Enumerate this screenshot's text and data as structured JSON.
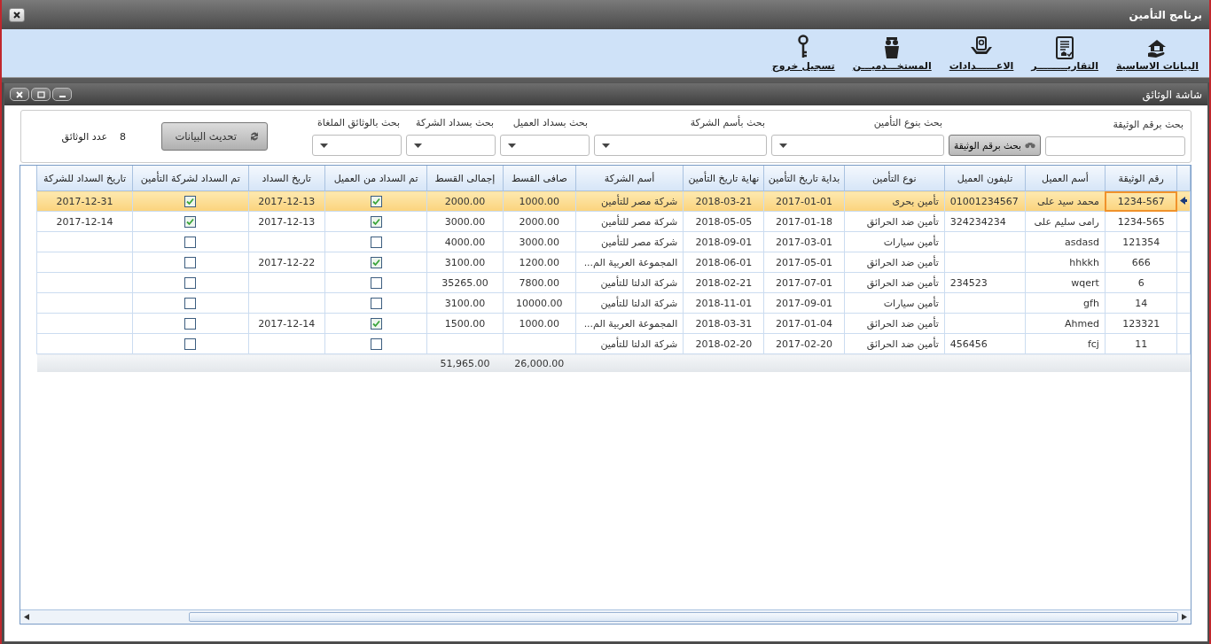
{
  "window": {
    "title": "برنامج التأمين"
  },
  "ribbon": [
    {
      "label": "البيانات الاساسية"
    },
    {
      "label": "التقاريـــــــــر"
    },
    {
      "label": "الاعــــــدادات"
    },
    {
      "label": "المستخـــدميـــن"
    },
    {
      "label": "تسجيل خروج"
    }
  ],
  "child_window": {
    "title": "شاشة الوثائق"
  },
  "filters": [
    {
      "label": "بحث برقم الوثيقة",
      "kind": "text"
    },
    {
      "kind": "button",
      "label": "بحث برقم الوثيقة"
    },
    {
      "label": "بحث بنوع التأمين",
      "kind": "combo"
    },
    {
      "label": "بحث بأسم الشركة",
      "kind": "combo"
    },
    {
      "label": "بحث بسداد العميل",
      "kind": "combo"
    },
    {
      "label": "بحث بسداد الشركة",
      "kind": "combo"
    },
    {
      "label": "بحث بالوثائق الملغاة",
      "kind": "combo"
    }
  ],
  "refresh_button": "تحديث البيانات",
  "count": {
    "value": "8",
    "label": "عدد الوثائق"
  },
  "table": {
    "columns": [
      {
        "label": "رقم الوثيقة",
        "kind": "text"
      },
      {
        "label": "أسم العميل",
        "kind": "text"
      },
      {
        "label": "تليفون العميل",
        "kind": "text"
      },
      {
        "label": "نوع التأمين",
        "kind": "text"
      },
      {
        "label": "بداية تاريخ التأمين",
        "kind": "text"
      },
      {
        "label": "نهاية تاريخ التأمين",
        "kind": "text"
      },
      {
        "label": "أسم الشركة",
        "kind": "text"
      },
      {
        "label": "صافى القسط",
        "kind": "text"
      },
      {
        "label": "إجمالى القسط",
        "kind": "text"
      },
      {
        "label": "تم السداد من العميل",
        "kind": "check"
      },
      {
        "label": "تاريخ السداد",
        "kind": "text"
      },
      {
        "label": "تم السداد لشركة التأمين",
        "kind": "check"
      },
      {
        "label": "تاريخ السداد للشركة",
        "kind": "text"
      }
    ],
    "rows": [
      {
        "selected": true,
        "cells": [
          "1234-567",
          "محمد سيد على",
          "01001234567",
          "تأمين بحرى",
          "2017-01-01",
          "2018-03-21",
          "شركة مصر للتأمين",
          "1000.00",
          "2000.00",
          true,
          "2017-12-13",
          true,
          "2017-12-31"
        ]
      },
      {
        "selected": false,
        "cells": [
          "1234-565",
          "رامى سليم على",
          "324234234",
          "تأمين ضد الحرائق",
          "2017-01-18",
          "2018-05-05",
          "شركة مصر للتأمين",
          "2000.00",
          "3000.00",
          true,
          "2017-12-13",
          true,
          "2017-12-14"
        ]
      },
      {
        "selected": false,
        "cells": [
          "121354",
          "asdasd",
          null,
          "تأمين سيارات",
          "2017-03-01",
          "2018-09-01",
          "شركة مصر للتأمين",
          "3000.00",
          "4000.00",
          false,
          null,
          false,
          null
        ]
      },
      {
        "selected": false,
        "cells": [
          "666",
          "hhkkh",
          null,
          "تأمين ضد الحرائق",
          "2017-05-01",
          "2018-06-01",
          "المجموعة العربية الم...",
          "1200.00",
          "3100.00",
          true,
          "2017-12-22",
          false,
          null
        ]
      },
      {
        "selected": false,
        "cells": [
          "6",
          "wqert",
          "234523",
          "تأمين ضد الحرائق",
          "2017-07-01",
          "2018-02-21",
          "شركة الدلتا للتأمين",
          "7800.00",
          "35265.00",
          false,
          null,
          false,
          null
        ]
      },
      {
        "selected": false,
        "cells": [
          "14",
          "gfh",
          null,
          "تأمين سيارات",
          "2017-09-01",
          "2018-11-01",
          "شركة الدلتا للتأمين",
          "10000.00",
          "3100.00",
          false,
          null,
          false,
          null
        ]
      },
      {
        "selected": false,
        "cells": [
          "123321",
          "Ahmed",
          null,
          "تأمين ضد الحرائق",
          "2017-01-04",
          "2018-03-31",
          "المجموعة العربية الم...",
          "1000.00",
          "1500.00",
          true,
          "2017-12-14",
          false,
          null
        ]
      },
      {
        "selected": false,
        "cells": [
          "11",
          "fcj",
          "456456",
          "تأمين ضد الحرائق",
          "2017-02-20",
          "2018-02-20",
          "شركة الدلتا للتأمين",
          null,
          null,
          false,
          null,
          false,
          null
        ]
      }
    ],
    "totals": {
      "net_premium": "26,000.00",
      "total_premium": "51,965.00"
    }
  }
}
